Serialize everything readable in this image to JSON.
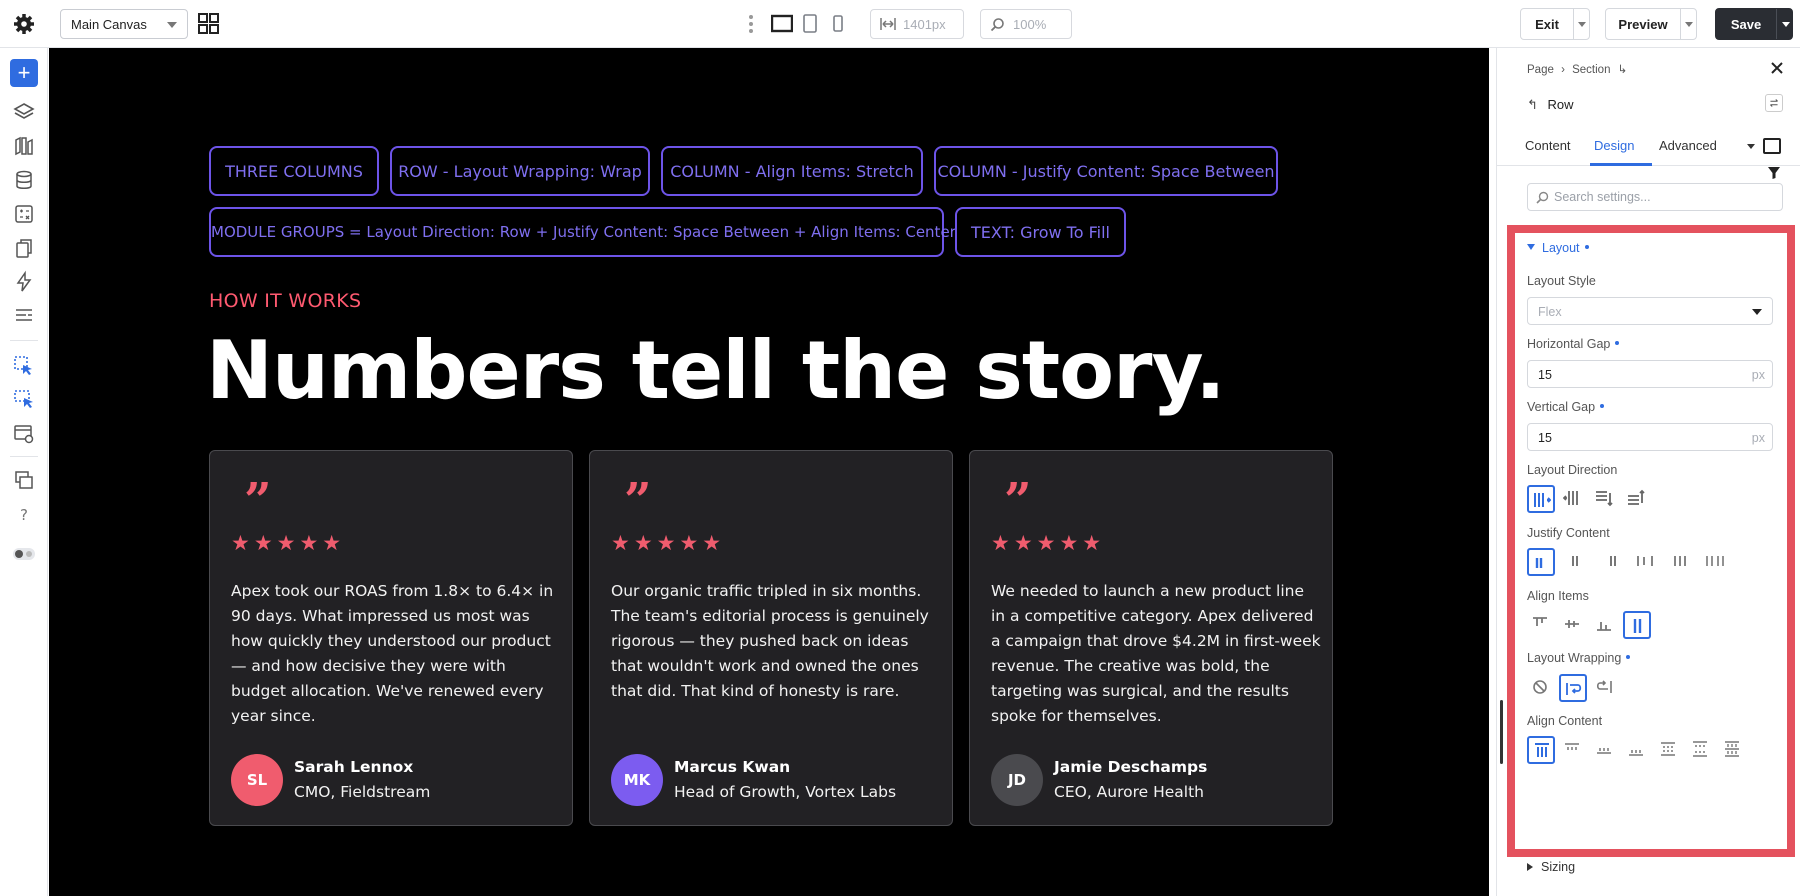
{
  "topbar": {
    "canvas_select": "Main Canvas",
    "width_value": "1401px",
    "zoom_value": "100%",
    "exit_label": "Exit",
    "preview_label": "Preview",
    "save_label": "Save"
  },
  "canvas": {
    "tags": [
      "THREE COLUMNS",
      "ROW - Layout Wrapping: Wrap",
      "COLUMN - Align Items: Stretch",
      "COLUMN - Justify Content: Space Between",
      "MODULE GROUPS = Layout Direction: Row + Justify Content: Space Between + Align Items: Center",
      "TEXT: Grow To Fill"
    ],
    "eyebrow": "HOW IT WORKS",
    "headline": "Numbers tell the story.",
    "quote_mark": "”",
    "stars": "★★★★★",
    "cards": [
      {
        "text": "Apex took our ROAS from 1.8× to 6.4× in 90 days. What impressed us most was how quickly they understood our product — and how decisive they were with budget allocation. We've renewed every year since.",
        "initials": "SL",
        "name": "Sarah Lennox",
        "role": "CMO, Fieldstream",
        "avatar_color": "#f05c6e"
      },
      {
        "text": "Our organic traffic tripled in six months. The team's editorial process is genuinely rigorous — they pushed back on ideas that wouldn't work and owned the ones that did. That kind of honesty is rare.",
        "initials": "MK",
        "name": "Marcus Kwan",
        "role": "Head of Growth, Vortex Labs",
        "avatar_color": "#7c5cf0"
      },
      {
        "text": "We needed to launch a new product line in a competitive category. Apex delivered a campaign that drove $4.2M in first-week revenue. The creative was bold, the targeting was surgical, and the results spoke for themselves.",
        "initials": "JD",
        "name": "Jamie Deschamps",
        "role": "CEO, Aurore Health",
        "avatar_color": "#4a4a4e"
      }
    ]
  },
  "panel": {
    "breadcrumb": [
      "Page",
      "›",
      "Section",
      "↳"
    ],
    "element_label": "Row",
    "tabs": [
      "Content",
      "Design",
      "Advanced"
    ],
    "search_placeholder": "Search settings...",
    "group_title": "Layout",
    "layout_style_label": "Layout Style",
    "layout_style_value": "Flex",
    "horizontal_gap_label": "Horizontal Gap",
    "horizontal_gap_value": "15",
    "vertical_gap_label": "Vertical Gap",
    "vertical_gap_value": "15",
    "unit": "px",
    "layout_direction_label": "Layout Direction",
    "justify_content_label": "Justify Content",
    "align_items_label": "Align Items",
    "layout_wrapping_label": "Layout Wrapping",
    "align_content_label": "Align Content",
    "sizing_label": "Sizing"
  },
  "colors": {
    "accent": "#2f6ce0",
    "tag_border": "#6d54e8",
    "highlight": "#e4525e",
    "brand_pink": "#f05c6e"
  }
}
